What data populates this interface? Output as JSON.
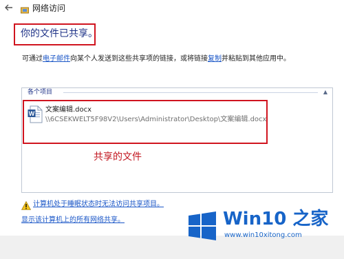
{
  "window": {
    "title": "网络访问"
  },
  "heading": "你的文件已共享。",
  "description": {
    "prefix": "可通过",
    "email_link": "电子邮件",
    "middle": "向某个人发送到这些共享项的链接，或将链接",
    "copy_link": "复制",
    "suffix": "并粘贴到其他应用中。"
  },
  "items_panel": {
    "header": "各个项目",
    "files": [
      {
        "name": "文案编辑.docx",
        "path": "\\\\6CSEKWELT5F98V2\\Users\\Administrator\\Desktop\\文案编辑.docx"
      }
    ]
  },
  "annotation": {
    "shared_label": "共享的文件"
  },
  "links": {
    "sleep_warning": "计算机处于睡眠状态时无法访问共享项目。",
    "show_all": "显示该计算机上的所有网络共享。"
  },
  "watermark": {
    "title": "Win10 之家",
    "subtitle": "www.win10xitong.com"
  },
  "colors": {
    "heading": "#1e3287",
    "link": "#1a56c7",
    "annotation_red": "#d0131e",
    "watermark_blue": "#1764c8"
  },
  "icons": {
    "back": "back-arrow-icon",
    "title": "network-share-icon",
    "file": "word-document-icon",
    "warning": "warning-icon",
    "logo": "windows-logo-icon"
  }
}
